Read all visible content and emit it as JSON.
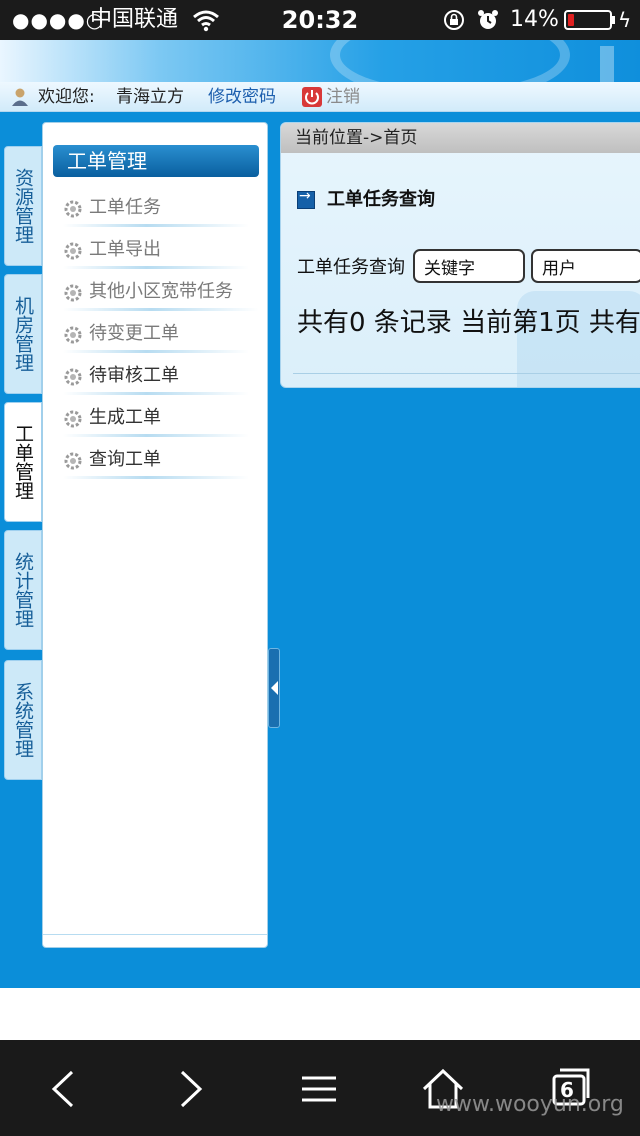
{
  "status_bar": {
    "signal": "●●●●○",
    "carrier": "中国联通",
    "time": "20:32",
    "battery_percent": "14%",
    "battery_level": 0.14,
    "battery_color": "#e02020"
  },
  "user_bar": {
    "welcome_label": "欢迎您:",
    "username": "青海立方",
    "change_password": "修改密码",
    "logout": "注销"
  },
  "vertical_tabs": [
    {
      "label": "资源管理",
      "active": false
    },
    {
      "label": "机房管理",
      "active": false
    },
    {
      "label": "工单管理",
      "active": true
    },
    {
      "label": "统计管理",
      "active": false
    },
    {
      "label": "系统管理",
      "active": false
    }
  ],
  "side_menu": {
    "header": "工单管理",
    "items": [
      {
        "label": "工单任务"
      },
      {
        "label": "工单导出"
      },
      {
        "label": "其他小区宽带任务"
      },
      {
        "label": "待变更工单"
      },
      {
        "label": "待审核工单"
      },
      {
        "label": "生成工单"
      },
      {
        "label": "查询工单"
      }
    ]
  },
  "content": {
    "breadcrumb": "当前位置->首页",
    "section_title": "工单任务查询",
    "query_label": "工单任务查询",
    "keyword_value": "关键字",
    "user_value": "用户",
    "record_summary": "共有0 条记录 当前第1页 共有"
  },
  "browser_toolbar": {
    "back_icon": "chevron-left-icon",
    "forward_icon": "chevron-right-icon",
    "menu_icon": "hamburger-icon",
    "home_icon": "home-icon",
    "tabs_icon": "tabs-icon",
    "tabs_count": "6"
  },
  "watermark": "www.wooyun.org",
  "colors": {
    "main_bg": "#0b8ed9",
    "menu_header": "#0a5f9f",
    "link": "#1d5fae"
  }
}
